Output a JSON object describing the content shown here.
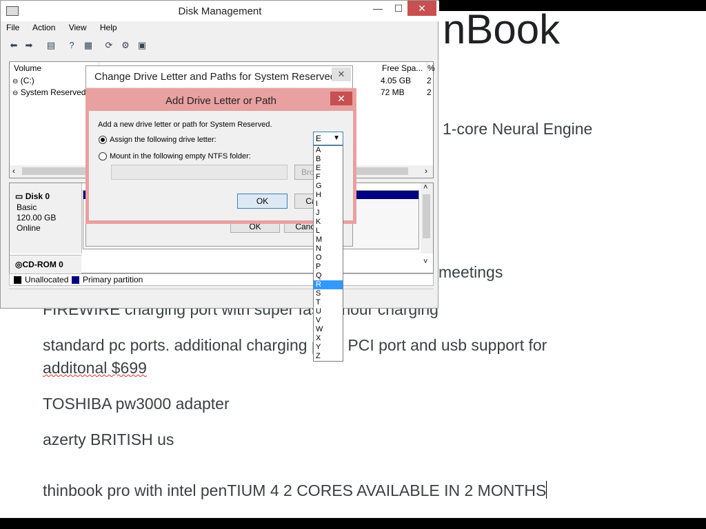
{
  "document": {
    "title_fragment": "nBook",
    "lines": [
      "1-core Neural Engine",
      "meetings",
      "FIREWIRE charging port with super fast 1 hour charging",
      "standard pc ports. additional charging port. PCI port and usb support for",
      "additonal $699",
      "TOSHIBA pw3000 adapter",
      "azerty BRITISH us",
      "thinbook pro with intel penTIUM 4 2 CORES AVAILABLE IN 2 MONTHS"
    ]
  },
  "disk_mgmt": {
    "title": "Disk Management",
    "menu": [
      "File",
      "Action",
      "View",
      "Help"
    ],
    "columns": [
      "Volume",
      "Free Spa...",
      "%"
    ],
    "volumes": [
      {
        "name": "(C:)",
        "free": "4.05 GB",
        "pct": "2"
      },
      {
        "name": "System Reserved",
        "free": "72 MB",
        "pct": "2"
      }
    ],
    "disks": [
      {
        "name": "Disk 0",
        "type": "Basic",
        "size": "120.00 GB",
        "status": "Online"
      },
      {
        "name": "CD-ROM 0"
      }
    ],
    "legend": [
      "Unallocated",
      "Primary partition"
    ],
    "colors": {
      "unallocated": "#000000",
      "primary": "#000080"
    }
  },
  "change_dialog": {
    "title": "Change Drive Letter and Paths for System Reserved",
    "ok": "OK",
    "cancel": "Cancel"
  },
  "add_dialog": {
    "title": "Add Drive Letter or Path",
    "intro": "Add a new drive letter or path for System Reserved.",
    "assign_label": "Assign the following drive letter:",
    "mount_label": "Mount in the following empty NTFS folder:",
    "browse": "Browse...",
    "ok": "OK",
    "cancel": "Cancel",
    "selected_letter": "E"
  },
  "letter_options": [
    "A",
    "B",
    "E",
    "F",
    "G",
    "H",
    "I",
    "J",
    "K",
    "L",
    "M",
    "N",
    "O",
    "P",
    "Q",
    "R",
    "S",
    "T",
    "U",
    "V",
    "W",
    "X",
    "Y",
    "Z"
  ],
  "highlighted_letter": "R"
}
